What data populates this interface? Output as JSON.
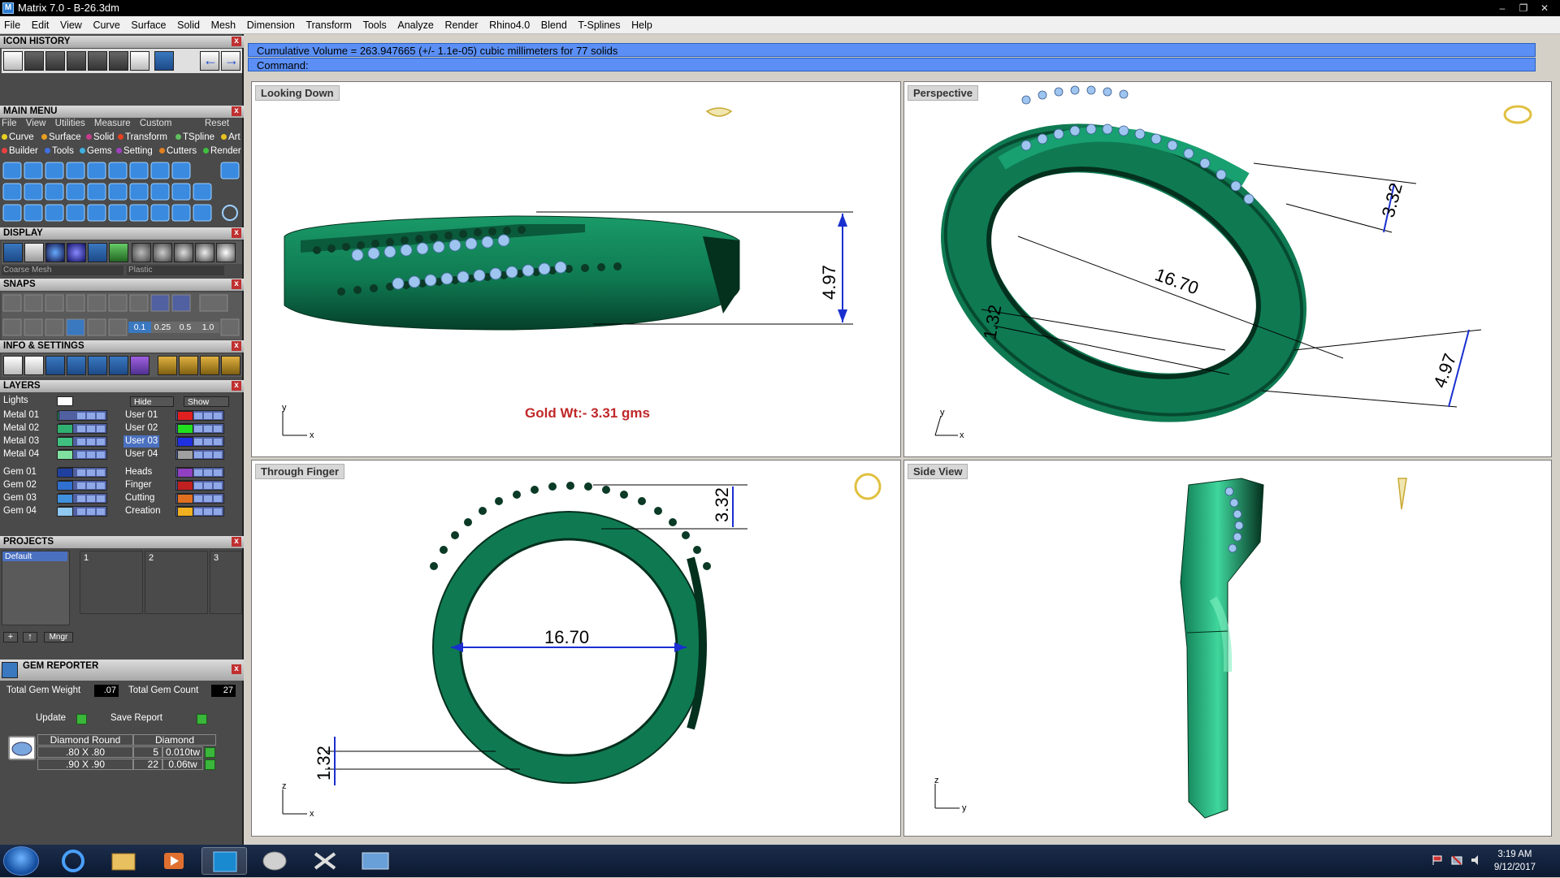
{
  "window": {
    "title": "Matrix 7.0 - B-26.3dm",
    "app_icon": "matrix-logo-icon"
  },
  "menu": [
    "File",
    "Edit",
    "View",
    "Curve",
    "Surface",
    "Solid",
    "Mesh",
    "Dimension",
    "Transform",
    "Tools",
    "Analyze",
    "Render",
    "Rhino4.0",
    "Blend",
    "T-Splines",
    "Help"
  ],
  "left_panel": {
    "icon_history_title": "ICON HISTORY",
    "main_menu_title": "MAIN MENU",
    "main_menu_tabs": [
      "File",
      "View",
      "Utilities",
      "Measure",
      "Custom"
    ],
    "main_menu_reset": "Reset",
    "categories_row1": [
      {
        "label": "Curve",
        "color": "#e8d020"
      },
      {
        "label": "Surface",
        "color": "#e8a020"
      },
      {
        "label": "Solid",
        "color": "#c83c8c"
      },
      {
        "label": "Transform",
        "color": "#e84020"
      },
      {
        "label": "TSpline",
        "color": "#60c060"
      },
      {
        "label": "Art",
        "color": "#e8c020"
      }
    ],
    "categories_row2": [
      {
        "label": "Builder",
        "color": "#e84040"
      },
      {
        "label": "Tools",
        "color": "#4070e0"
      },
      {
        "label": "Gems",
        "color": "#40b0e0"
      },
      {
        "label": "Setting",
        "color": "#a040c0"
      },
      {
        "label": "Cutters",
        "color": "#e08020"
      },
      {
        "label": "Render",
        "color": "#40c040"
      }
    ],
    "display_title": "DISPLAY",
    "display_mesh": "Coarse Mesh",
    "display_material": "Plastic",
    "snaps_title": "SNAPS",
    "snap_values": [
      "0.1",
      "0.25",
      "0.5",
      "1.0"
    ],
    "info_title": "INFO & SETTINGS",
    "layers_title": "LAYERS",
    "lights_label": "Lights",
    "hide_label": "Hide",
    "show_label": "Show",
    "layers_left": [
      {
        "name": "Metal 01",
        "color": "#20a060"
      },
      {
        "name": "Metal 02",
        "color": "#30b070"
      },
      {
        "name": "Metal 03",
        "color": "#40c080"
      },
      {
        "name": "Metal 04",
        "color": "#80e0a0"
      },
      {
        "name": "Gem 01",
        "color": "#2040a0"
      },
      {
        "name": "Gem 02",
        "color": "#3070d0"
      },
      {
        "name": "Gem 03",
        "color": "#4090e0"
      },
      {
        "name": "Gem 04",
        "color": "#90c8f0"
      }
    ],
    "layers_right": [
      {
        "name": "User 01",
        "color": "#e02020"
      },
      {
        "name": "User 02",
        "color": "#20e020"
      },
      {
        "name": "User 03",
        "color": "#2030e0"
      },
      {
        "name": "User 04",
        "color": "#a0a0a0"
      },
      {
        "name": "Heads",
        "color": "#9040c0"
      },
      {
        "name": "Finger",
        "color": "#c02020"
      },
      {
        "name": "Cutting",
        "color": "#e07020"
      },
      {
        "name": "Creation",
        "color": "#f0b020"
      }
    ],
    "projects_title": "PROJECTS",
    "projects_default": "Default",
    "project_slots": [
      "1",
      "2",
      "3"
    ],
    "mngr_label": "Mngr",
    "gem_reporter_title": "GEM REPORTER",
    "total_gem_weight_label": "Total Gem Weight",
    "total_gem_weight": ".07",
    "total_gem_count_label": "Total Gem Count",
    "total_gem_count": "27",
    "update_label": "Update",
    "save_report_label": "Save Report",
    "gem_headers": [
      "Diamond Round",
      "Diamond"
    ],
    "gem_rows": [
      {
        "size": ".80 X .80",
        "count": "5",
        "weight": "0.010tw"
      },
      {
        "size": ".90 X .90",
        "count": "22",
        "weight": "0.06tw"
      }
    ]
  },
  "command": {
    "output": "Cumulative Volume = 263.947665 (+/- 1.1e-05) cubic millimeters for 77 solids",
    "prompt": "Command:"
  },
  "viewports": {
    "top_left": {
      "label": "Looking Down",
      "dimension": "4.97",
      "note": "Gold Wt:- 3.31 gms",
      "axis_y": "y",
      "axis_x": "x"
    },
    "top_right": {
      "label": "Perspective",
      "dim_a": "3.32",
      "dim_b": "16.70",
      "dim_c": "1.32",
      "dim_d": "4.97",
      "axis_y": "y",
      "axis_x": "x"
    },
    "bottom_left": {
      "label": "Through Finger",
      "dim_a": "3.32",
      "dim_b": "16.70",
      "dim_c": "1.32",
      "axis_z": "z",
      "axis_x": "x"
    },
    "bottom_right": {
      "label": "Side View",
      "axis_z": "z",
      "axis_y": "y"
    }
  },
  "taskbar": {
    "time": "3:19 AM",
    "date": "9/12/2017"
  },
  "colors": {
    "ring": "#0f7a52",
    "ring_dark": "#064a30",
    "gem": "#9ec4f0",
    "dimension": "#1a2fd0",
    "note": "#c0282a"
  }
}
